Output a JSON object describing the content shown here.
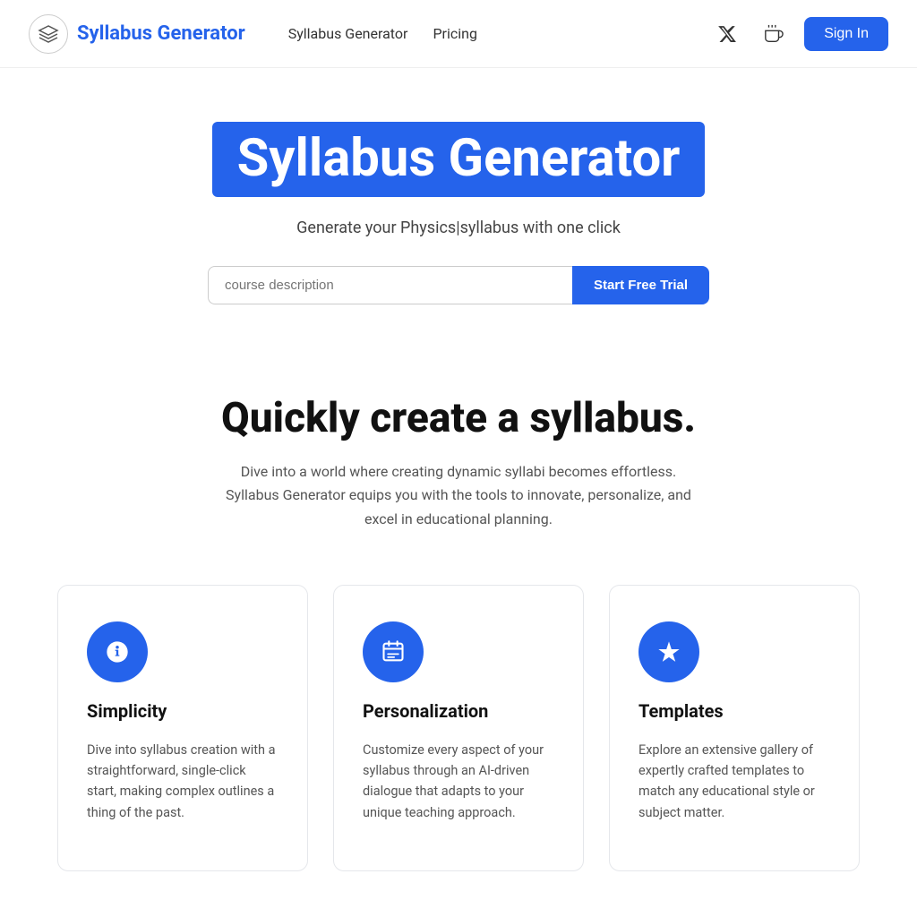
{
  "nav": {
    "logo_text": "Syllabus Generator",
    "links": [
      {
        "label": "Syllabus Generator",
        "id": "nav-syllabus"
      },
      {
        "label": "Pricing",
        "id": "nav-pricing"
      }
    ],
    "signin_label": "Sign In"
  },
  "hero": {
    "title": "Syllabus Generator",
    "subtitle": "Generate your Physics|syllabus with one click",
    "input_placeholder": "course description",
    "cta_label": "Start Free Trial"
  },
  "tagline": {
    "heading": "Quickly create a syllabus.",
    "body": "Dive into a world where creating dynamic syllabi becomes effortless. Syllabus Generator equips you with the tools to innovate, personalize, and excel in educational planning."
  },
  "cards": [
    {
      "id": "simplicity",
      "icon": "⚙️",
      "title": "Simplicity",
      "body": "Dive into syllabus creation with a straightforward, single-click start, making complex outlines a thing of the past."
    },
    {
      "id": "personalization",
      "icon": "📋",
      "title": "Personalization",
      "body": "Customize every aspect of your syllabus through an AI-driven dialogue that adapts to your unique teaching approach."
    },
    {
      "id": "templates",
      "icon": "✳",
      "title": "Templates",
      "body": "Explore an extensive gallery of expertly crafted templates to match any educational style or subject matter."
    }
  ]
}
